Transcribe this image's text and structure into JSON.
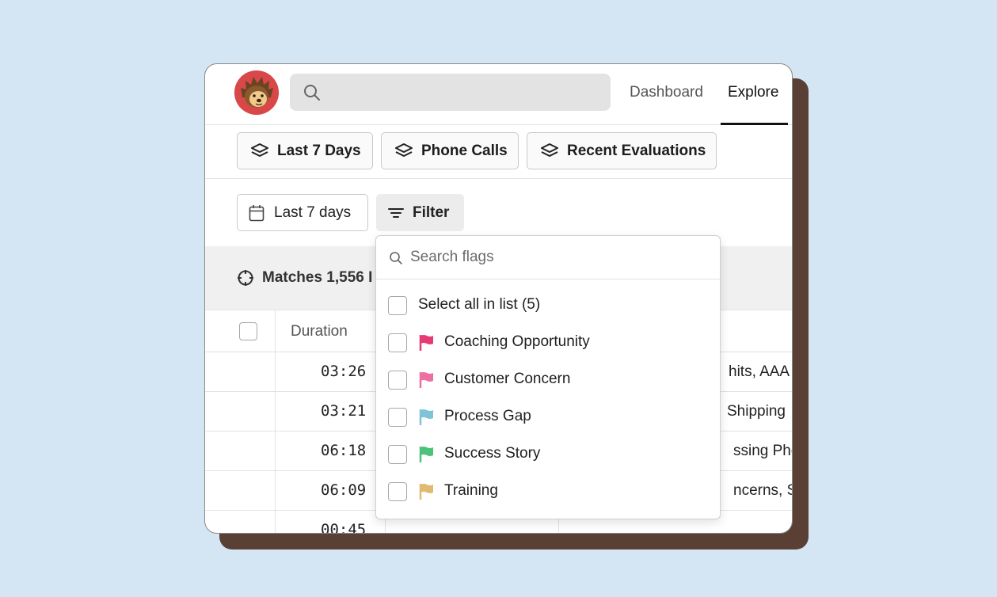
{
  "header": {
    "search": {
      "placeholder": ""
    },
    "nav": [
      {
        "label": "Dashboard",
        "active": false
      },
      {
        "label": "Explore",
        "active": true
      }
    ]
  },
  "views": [
    {
      "label": "Last 7 Days",
      "icon": "layers-icon"
    },
    {
      "label": "Phone Calls",
      "icon": "layers-icon"
    },
    {
      "label": "Recent Evaluations",
      "icon": "layers-icon"
    }
  ],
  "filters": {
    "date_label": "Last 7 days",
    "filter_label": "Filter"
  },
  "matches": {
    "text": "Matches 1,556 I"
  },
  "table": {
    "columns": [
      "Duration"
    ],
    "rows": [
      {
        "duration": "03:26",
        "tags": "hits, AAA D"
      },
      {
        "duration": "03:21",
        "tags": "Shipping"
      },
      {
        "duration": "06:18",
        "tags": "ssing Photo"
      },
      {
        "duration": "06:09",
        "tags": "ncerns, Shi"
      },
      {
        "duration": "00:45",
        "tags": ""
      }
    ]
  },
  "dropdown": {
    "search_placeholder": "Search flags",
    "select_all": "Select all in list (5)",
    "flags": [
      {
        "label": "Coaching Opportunity",
        "color": "#e53a73"
      },
      {
        "label": "Customer Concern",
        "color": "#f06fa3"
      },
      {
        "label": "Process Gap",
        "color": "#7fc4d6"
      },
      {
        "label": "Success Story",
        "color": "#4cc27b"
      },
      {
        "label": "Training",
        "color": "#e2b970"
      }
    ]
  },
  "colors": {
    "background": "#d4e6f4",
    "card_shadow": "#5a4034",
    "avatar_bg": "#d94848"
  }
}
